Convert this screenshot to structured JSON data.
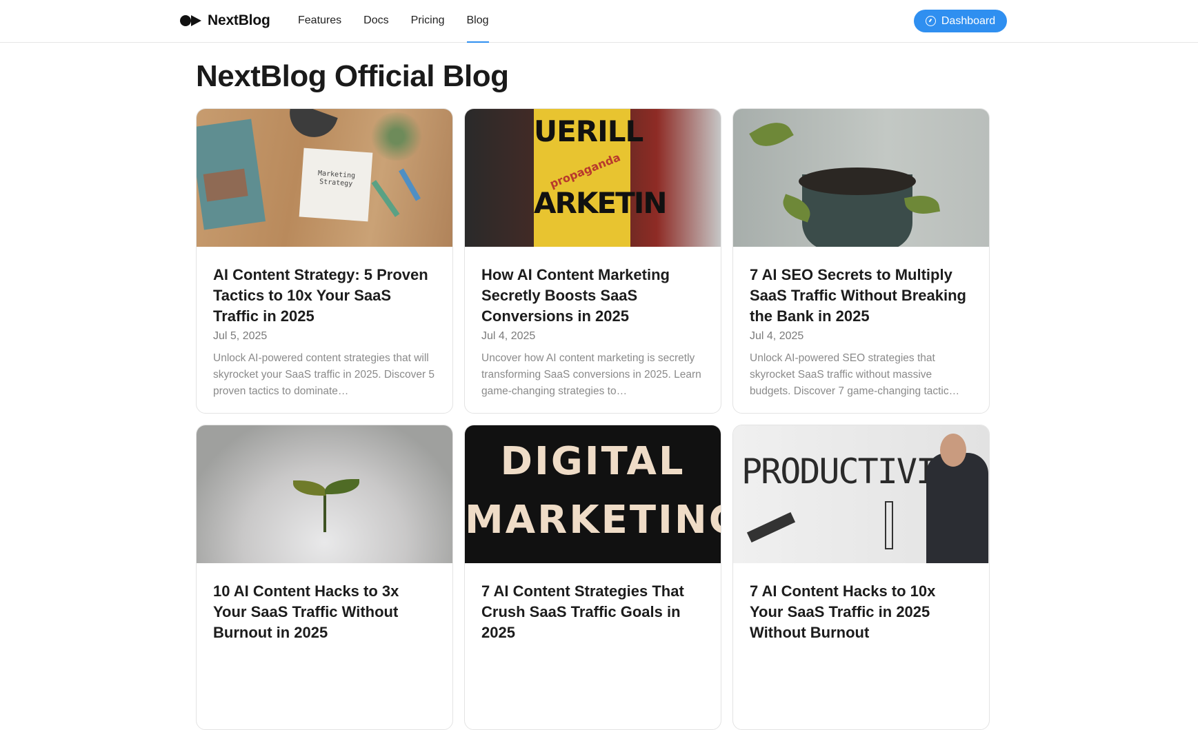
{
  "header": {
    "brand": "NextBlog",
    "nav": [
      {
        "label": "Features",
        "active": false
      },
      {
        "label": "Docs",
        "active": false
      },
      {
        "label": "Pricing",
        "active": false
      },
      {
        "label": "Blog",
        "active": true
      }
    ],
    "dashboard_label": "Dashboard",
    "accent_color": "#2f8ff0"
  },
  "page": {
    "title": "NextBlog Official Blog"
  },
  "posts": [
    {
      "title": "AI Content Strategy: 5 Proven Tactics to 10x Your SaaS Traffic in 2025",
      "date": "Jul 5, 2025",
      "excerpt": "Unlock AI-powered content strategies that will skyrocket your SaaS traffic in 2025. Discover 5 proven tactics to dominate…",
      "image": "marketing-strategy-desk-photo",
      "image_text": [
        "Marketing",
        "Strategy"
      ]
    },
    {
      "title": "How AI Content Marketing Secretly Boosts SaaS Conversions in 2025",
      "date": "Jul 4, 2025",
      "excerpt": "Uncover how AI content marketing is secretly transforming SaaS conversions in 2025. Learn game-changing strategies to…",
      "image": "guerilla-marketing-can-photo",
      "image_text": [
        "UERILL",
        "propaganda",
        "ARKETIN"
      ]
    },
    {
      "title": "7 AI SEO Secrets to Multiply SaaS Traffic Without Breaking the Bank in 2025",
      "date": "Jul 4, 2025",
      "excerpt": "Unlock AI-powered SEO strategies that skyrocket SaaS traffic without massive budgets. Discover 7 game-changing tactic…",
      "image": "potted-plant-photo"
    },
    {
      "title": "10 AI Content Hacks to 3x Your SaaS Traffic Without Burnout in 2025",
      "date": "",
      "excerpt": "",
      "image": "seedling-in-sand-photo"
    },
    {
      "title": "7 AI Content Strategies That Crush SaaS Traffic Goals in 2025",
      "date": "",
      "excerpt": "",
      "image": "digital-marketing-letters-photo",
      "image_text": [
        "DIGITAL",
        "MARKETING"
      ]
    },
    {
      "title": "7 AI Content Hacks to 10x Your SaaS Traffic in 2025 Without Burnout",
      "date": "",
      "excerpt": "",
      "image": "productivity-wall-man-photo",
      "image_text": [
        "PRODUCTIVITY"
      ]
    }
  ]
}
